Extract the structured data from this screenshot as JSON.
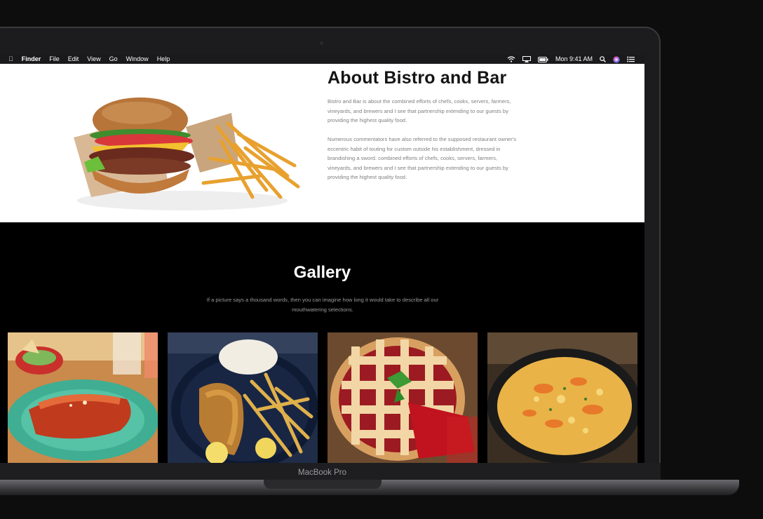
{
  "menubar": {
    "apple": "",
    "items": [
      "Finder",
      "File",
      "Edit",
      "View",
      "Go",
      "Window",
      "Help"
    ],
    "clock": "Mon 9:41 AM",
    "status_icons": [
      "wifi-icon",
      "airplay-icon",
      "battery-icon",
      "search-icon",
      "siri-icon",
      "control-center-icon"
    ]
  },
  "about": {
    "title": "About Bistro and Bar",
    "paragraph1": "Bistro and Bar is about the combined efforts of chefs, cooks, servers, farmers, vineyards, and brewers and I see that partnership extending to our guests by providing the highest quality food.",
    "paragraph2": "Numerous commentators have also referred to the supposed restaurant owner's eccentric habit of touting for custom outside his establishment, dressed in brandishing a sword. combined efforts of chefs, cooks, servers, farmers, vineyards, and brewers and I see that partnership extending to our guests by providing the highest quality food."
  },
  "gallery": {
    "title": "Gallery",
    "subtitle": "If a picture says a thousand words, then you can imagine how long it would take to describe all our mouthwatering selections.",
    "images": [
      "burrito",
      "fried-fish",
      "cherry-pie",
      "mac-and-cheese"
    ]
  },
  "device": {
    "label": "MacBook Pro"
  },
  "colors": {
    "screen_bg": "#000000",
    "about_bg": "#ffffff",
    "heading": "#141414",
    "body_text": "#808080"
  }
}
